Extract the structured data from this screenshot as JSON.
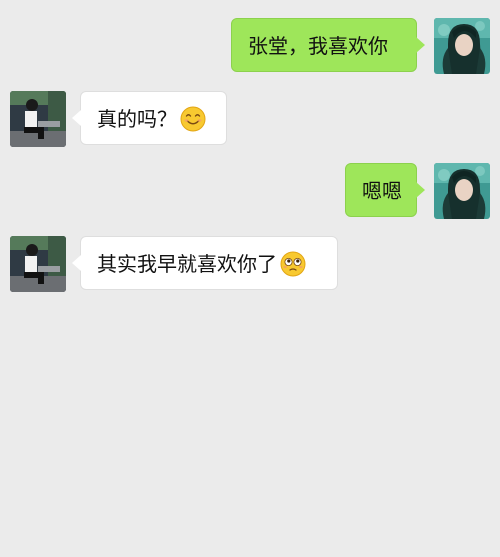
{
  "messages": [
    {
      "side": "sent",
      "avatar": "girl-avatar",
      "text": "张堂，我喜欢你",
      "emoji": ""
    },
    {
      "side": "received",
      "avatar": "boy-avatar",
      "text": "真的吗？",
      "emoji": "smiling-face-icon"
    },
    {
      "side": "sent",
      "avatar": "girl-avatar",
      "text": "嗯嗯",
      "emoji": ""
    },
    {
      "side": "received",
      "avatar": "boy-avatar",
      "text": "其实我早就喜欢你了",
      "emoji": "pleading-face-icon"
    }
  ],
  "colors": {
    "background": "#ebebeb",
    "sent_bubble": "#9ee65a",
    "received_bubble": "#ffffff"
  }
}
